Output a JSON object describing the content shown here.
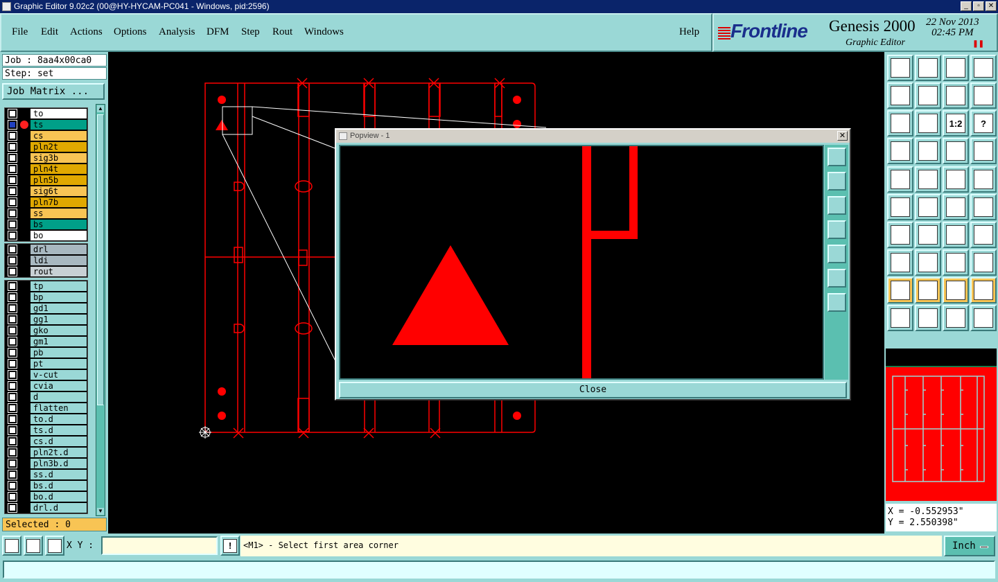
{
  "window": {
    "title": "Graphic Editor 9.02c2 (00@HY-HYCAM-PC041 - Windows, pid:2596)",
    "controls": [
      "_",
      "▫",
      "✕"
    ]
  },
  "menu": {
    "items": [
      "File",
      "Edit",
      "Actions",
      "Options",
      "Analysis",
      "DFM",
      "Step",
      "Rout",
      "Windows"
    ],
    "help": "Help"
  },
  "brand": {
    "logo": "Frontline",
    "product": "Genesis 2000",
    "subtitle": "Graphic Editor",
    "date": "22 Nov 2013",
    "time": "02:45 PM"
  },
  "left_panel": {
    "job": "Job : 8aa4x00ca0",
    "step": "Step: set",
    "job_matrix_button": "Job Matrix ...",
    "selected": "Selected : 0"
  },
  "layers": {
    "board": [
      {
        "name": "to",
        "color": "#ffffff"
      },
      {
        "name": "ts",
        "color": "#00a088",
        "active": true
      },
      {
        "name": "cs",
        "color": "#f8c454"
      },
      {
        "name": "pln2t",
        "color": "#e0a800"
      },
      {
        "name": "sig3b",
        "color": "#f8c454"
      },
      {
        "name": "pln4t",
        "color": "#e0a800"
      },
      {
        "name": "pln5b",
        "color": "#e0a800"
      },
      {
        "name": "sig6t",
        "color": "#f8c454"
      },
      {
        "name": "pln7b",
        "color": "#e0a800"
      },
      {
        "name": "ss",
        "color": "#f8c454"
      },
      {
        "name": "bs",
        "color": "#00a088"
      },
      {
        "name": "bo",
        "color": "#ffffff"
      }
    ],
    "drill": [
      {
        "name": "drl",
        "color": "#a8b8c0"
      },
      {
        "name": "ldi",
        "color": "#a8b8c0"
      },
      {
        "name": "rout",
        "color": "#c8d0d4"
      }
    ],
    "misc": [
      {
        "name": "tp",
        "color": "#9ad8d6"
      },
      {
        "name": "bp",
        "color": "#9ad8d6"
      },
      {
        "name": "gd1",
        "color": "#9ad8d6"
      },
      {
        "name": "gg1",
        "color": "#9ad8d6"
      },
      {
        "name": "gko",
        "color": "#9ad8d6"
      },
      {
        "name": "gm1",
        "color": "#9ad8d6"
      },
      {
        "name": "pb",
        "color": "#9ad8d6"
      },
      {
        "name": "pt",
        "color": "#9ad8d6"
      },
      {
        "name": "v-cut",
        "color": "#9ad8d6"
      },
      {
        "name": "cvia",
        "color": "#9ad8d6"
      },
      {
        "name": "d",
        "color": "#9ad8d6"
      },
      {
        "name": "flatten",
        "color": "#9ad8d6"
      },
      {
        "name": "to.d",
        "color": "#9ad8d6"
      },
      {
        "name": "ts.d",
        "color": "#9ad8d6"
      },
      {
        "name": "cs.d",
        "color": "#9ad8d6"
      },
      {
        "name": "pln2t.d",
        "color": "#9ad8d6"
      },
      {
        "name": "pln3b.d",
        "color": "#9ad8d6"
      },
      {
        "name": "ss.d",
        "color": "#9ad8d6"
      },
      {
        "name": "bs.d",
        "color": "#9ad8d6"
      },
      {
        "name": "bo.d",
        "color": "#9ad8d6"
      },
      {
        "name": "drl.d",
        "color": "#9ad8d6"
      }
    ]
  },
  "popview": {
    "title": "Popview - 1",
    "close_button": "Close",
    "feature_color": "#ff0000"
  },
  "toolbar_right": {
    "labels": [
      "1:2",
      "?"
    ]
  },
  "coords": {
    "x": "X = -0.552953\"",
    "y": "Y = 2.550398\""
  },
  "bottom": {
    "xy_label": "X Y :",
    "xy_value": "",
    "prompt": "<M1> - Select first area corner",
    "units": "Inch"
  },
  "colors": {
    "panel": "#9ad8d6",
    "feature": "#ff0000",
    "outline": "#ffffff"
  }
}
